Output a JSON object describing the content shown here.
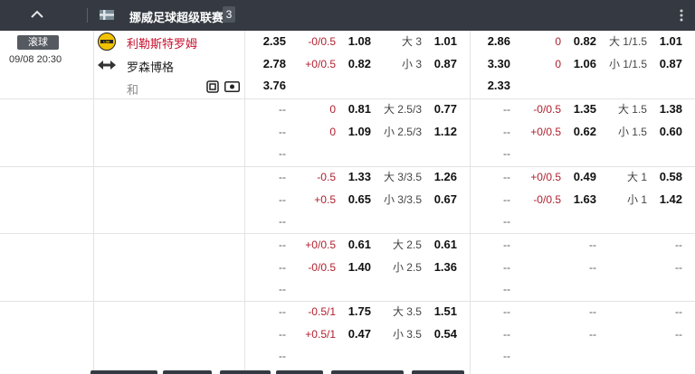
{
  "header": {
    "league_name": "挪威足球超级联赛",
    "match_count": "3"
  },
  "match": {
    "status": "滚球",
    "time": "09/08 20:30",
    "home": "利勒斯特罗姆",
    "away": "罗森博格",
    "draw": "和"
  },
  "rows": [
    [
      "2.35",
      "-0/0.5",
      "1.08",
      "大 3",
      "1.01",
      "2.86",
      "0",
      "0.82",
      "大 1/1.5",
      "1.01"
    ],
    [
      "2.78",
      "+0/0.5",
      "0.82",
      "小 3",
      "0.87",
      "3.30",
      "0",
      "1.06",
      "小 1/1.5",
      "0.87"
    ],
    [
      "3.76",
      "",
      "",
      "",
      "",
      "2.33",
      "",
      "",
      "",
      ""
    ],
    [
      "--",
      "0",
      "0.81",
      "大 2.5/3",
      "0.77",
      "--",
      "-0/0.5",
      "1.35",
      "大 1.5",
      "1.38"
    ],
    [
      "--",
      "0",
      "1.09",
      "小 2.5/3",
      "1.12",
      "--",
      "+0/0.5",
      "0.62",
      "小 1.5",
      "0.60"
    ],
    [
      "--",
      "",
      "",
      "",
      "",
      "--",
      "",
      "",
      "",
      ""
    ],
    [
      "--",
      "-0.5",
      "1.33",
      "大 3/3.5",
      "1.26",
      "--",
      "+0/0.5",
      "0.49",
      "大 1",
      "0.58"
    ],
    [
      "--",
      "+0.5",
      "0.65",
      "小 3/3.5",
      "0.67",
      "--",
      "-0/0.5",
      "1.63",
      "小 1",
      "1.42"
    ],
    [
      "--",
      "",
      "",
      "",
      "",
      "--",
      "",
      "",
      "",
      ""
    ],
    [
      "--",
      "+0/0.5",
      "0.61",
      "大 2.5",
      "0.61",
      "--",
      "",
      "--",
      "",
      "--"
    ],
    [
      "--",
      "-0/0.5",
      "1.40",
      "小 2.5",
      "1.36",
      "--",
      "",
      "--",
      "",
      "--"
    ],
    [
      "--",
      "",
      "",
      "",
      "",
      "--",
      "",
      "",
      "",
      ""
    ],
    [
      "--",
      "-0.5/1",
      "1.75",
      "大 3.5",
      "1.51",
      "--",
      "",
      "--",
      "",
      "--"
    ],
    [
      "--",
      "+0.5/1",
      "0.47",
      "小 3.5",
      "0.54",
      "--",
      "",
      "--",
      "",
      "--"
    ],
    [
      "--",
      "",
      "",
      "",
      "",
      "--",
      "",
      "",
      "",
      ""
    ]
  ]
}
